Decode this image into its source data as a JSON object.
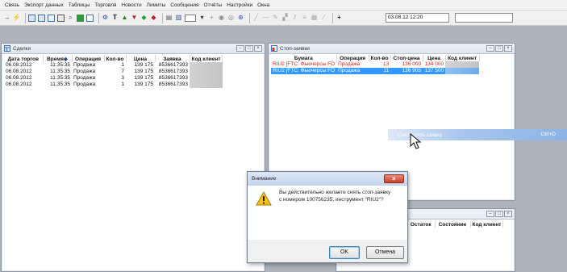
{
  "menu": [
    "Связь",
    "Экспорт данных",
    "Таблицы",
    "Торговля",
    "Новости",
    "Лимиты",
    "Сообщения",
    "Отчёты",
    "Настройки",
    "Окна"
  ],
  "toolbar": {
    "datetime": "03.08.12 12:20"
  },
  "deals": {
    "title": "Сделки",
    "columns": [
      "Дата торгов",
      "Время",
      "Операция",
      "Кол-во",
      "Цена",
      "Заявка",
      "Код клиент"
    ],
    "rows": [
      [
        "06.08.2012",
        "11:35:35",
        "Продажа",
        "1",
        "139 175",
        "8536617393",
        ""
      ],
      [
        "06.08.2012",
        "11:35:35",
        "Продажа",
        "7",
        "139 175",
        "8536617393",
        ""
      ],
      [
        "06.08.2012",
        "11:35:35",
        "Продажа",
        "3",
        "139 175",
        "8536617393",
        ""
      ],
      [
        "06.08.2012",
        "11:35:35",
        "Продажа",
        "1",
        "139 175",
        "8536617393",
        ""
      ]
    ]
  },
  "stops": {
    "title": "Стоп-заявки",
    "columns": [
      "Бумага",
      "Операция",
      "Кол-во",
      "Стоп-цена",
      "Цена",
      "Код клиент"
    ],
    "rows": [
      [
        "RIU2 [FTC: Фьючерсы FO",
        "Продажа",
        "13",
        "136 000",
        "134 000",
        ""
      ],
      [
        "RIU2 [FTC: Фьючерсы FO",
        "Продажа",
        "11",
        "136 905",
        "137 500",
        ""
      ]
    ]
  },
  "orders": {
    "columns": [
      "Остаток",
      "Состояние",
      "Код клиент"
    ]
  },
  "context_menu": {
    "label": "Снять стоп-заявку",
    "shortcut": "Ctrl+D"
  },
  "dialog": {
    "title": "Внимание",
    "message_line1": "Вы действительно желаете снять стоп-заявку",
    "message_line2": "с номером 100756235, инструмент \"RIU2\"?",
    "ok": "OK",
    "cancel": "Отмена"
  },
  "icons": [
    "deals-window-icon",
    "stops-window-icon",
    "warning-icon",
    "mouse-cursor-icon",
    "close-icon"
  ]
}
